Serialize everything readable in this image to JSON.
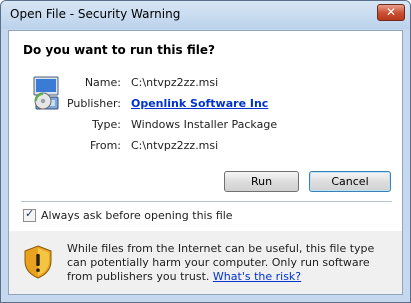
{
  "window": {
    "title": "Open File - Security Warning",
    "close_glyph": "✕"
  },
  "dialog": {
    "question": "Do you want to run this file?",
    "file_icon": "installer-package-icon",
    "fields": [
      {
        "label": "Name:",
        "value": "C:\\ntvpz2zz.msi"
      },
      {
        "label": "Publisher:",
        "value": "Openlink Software Inc"
      },
      {
        "label": "Type:",
        "value": "Windows Installer Package"
      },
      {
        "label": "From:",
        "value": "C:\\ntvpz2zz.msi"
      }
    ],
    "run_label": "Run",
    "cancel_label": "Cancel",
    "always_ask_label": "Always ask before opening this file",
    "always_ask_checked": true
  },
  "warning": {
    "icon": "shield-warning-icon",
    "text": "While files from the Internet can be useful, this file type can potentially harm your computer. Only run software from publishers you trust.",
    "link_label": "What's the risk?"
  },
  "colors": {
    "title_bar": "#c6d8ee",
    "link": "#0033cc",
    "close_button": "#c94d2e"
  }
}
